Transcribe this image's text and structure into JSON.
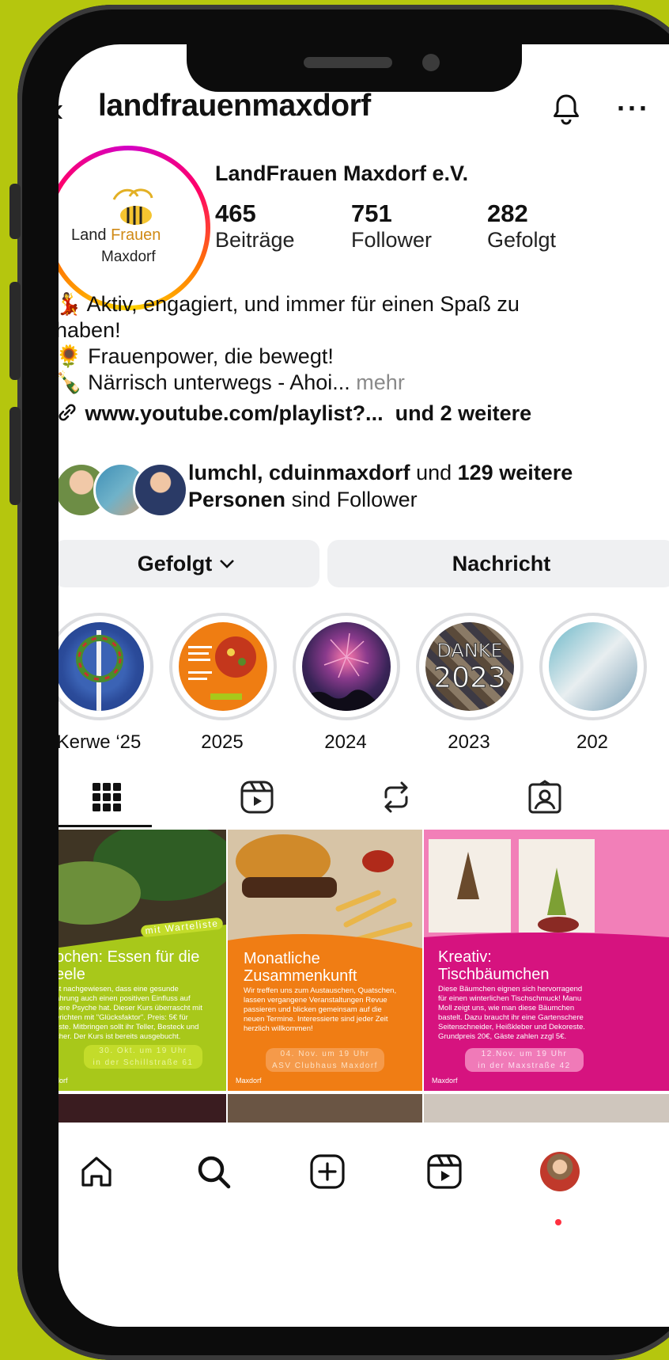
{
  "header": {
    "username": "landfrauenmaxdorf",
    "back_icon": "chevron-left-icon",
    "bell_icon": "bell-icon",
    "more_icon": "more-horizontal-icon",
    "more_glyph": "···"
  },
  "profile": {
    "avatar_logo": {
      "line1_a": "Land",
      "line1_b": "Frauen",
      "line2": "Maxdorf"
    },
    "full_name": "LandFrauen Maxdorf e.V.",
    "stats": [
      {
        "value": "465",
        "label": "Beiträge"
      },
      {
        "value": "751",
        "label": "Follower"
      },
      {
        "value": "282",
        "label": "Gefolgt"
      }
    ],
    "bio": {
      "line1_emoji": "💃",
      "line1": "Aktiv, engagiert, und immer für einen Spaß zu",
      "line2": "haben!",
      "line3_emoji": "🌻",
      "line3": "Frauenpower, die bewegt!",
      "line4_emoji": "🍾",
      "line4": "Närrisch unterwegs - Ahoi...",
      "more": "mehr"
    },
    "link": {
      "icon": "link-icon",
      "url": "www.youtube.com/playlist?...",
      "extra": "und 2 weitere"
    },
    "followed_by": {
      "names": "lumchl, cduinmaxdorf",
      "middle": "und",
      "count": "129 weitere",
      "personen": "Personen",
      "suffix": "sind Follower"
    }
  },
  "actions": {
    "follow_label": "Gefolgt",
    "follow_icon": "chevron-down-icon",
    "message_label": "Nachricht"
  },
  "highlights": [
    {
      "label": "Kerwe ‘25"
    },
    {
      "label": "2025"
    },
    {
      "label": "2024"
    },
    {
      "label": "2023",
      "image_text_top": "DANKE",
      "image_text_bottom": "2023"
    },
    {
      "label": "202"
    }
  ],
  "tabs": [
    {
      "icon": "grid-icon",
      "active": true
    },
    {
      "icon": "reels-icon"
    },
    {
      "icon": "repost-icon"
    },
    {
      "icon": "tagged-icon"
    }
  ],
  "posts": [
    {
      "title": "ochen: Essen für die\neele",
      "badge": "mit Warteliste",
      "body": "st nachgewiesen, dass eine gesunde\nährung auch einen positiven Einfluss auf\nsere Psyche hat. Dieser Kurs überrascht mit\nerichten mit \"Glücksfaktor\". Preis: 5€ für\nliste. Mitbringen sollt ihr Teller, Besteck und\ncher. Der Kurs ist bereits ausgebucht.",
      "pill": "30. Okt. um 19 Uhr\nin der Schillstraße 61",
      "footer": "dorf",
      "color": "#a8c81a"
    },
    {
      "title": "Monatliche\nZusammenkunft",
      "body": "Wir treffen uns zum Austauschen, Quatschen,\nlassen vergangene Veranstaltungen Revue\npassieren und blicken gemeinsam auf die\nneuen Termine. Interessierte sind jeder Zeit\nherzlich willkommen!",
      "pill": "04. Nov. um 19 Uhr\nASV Clubhaus Maxdorf",
      "footer": "Maxdorf",
      "color": "#f07d14"
    },
    {
      "title": "Kreativ:\nTischbäumchen",
      "body": "Diese Bäumchen eignen sich hervorragend\nfür einen winterlichen Tischschmuck! Manu\nMoll zeigt uns, wie man diese Bäumchen\nbastelt. Dazu braucht ihr eine Gartenschere\nSeitenschneider, Heißkleber und Dekoreste.\nGrundpreis 20€, Gäste zahlen zzgl 5€.",
      "pill": "12.Nov. um 19 Uhr\nin der Maxstraße 42",
      "footer": "Maxdorf",
      "color": "#d6137f"
    }
  ],
  "bottom_nav": [
    {
      "icon": "home-icon"
    },
    {
      "icon": "search-icon"
    },
    {
      "icon": "create-icon"
    },
    {
      "icon": "reels-icon"
    },
    {
      "icon": "profile-avatar-icon"
    }
  ],
  "colors": {
    "background": "#b5c60e",
    "text": "#111111",
    "muted": "#8a8a8a",
    "button": "#eff0f2",
    "notification": "#ff3040"
  }
}
